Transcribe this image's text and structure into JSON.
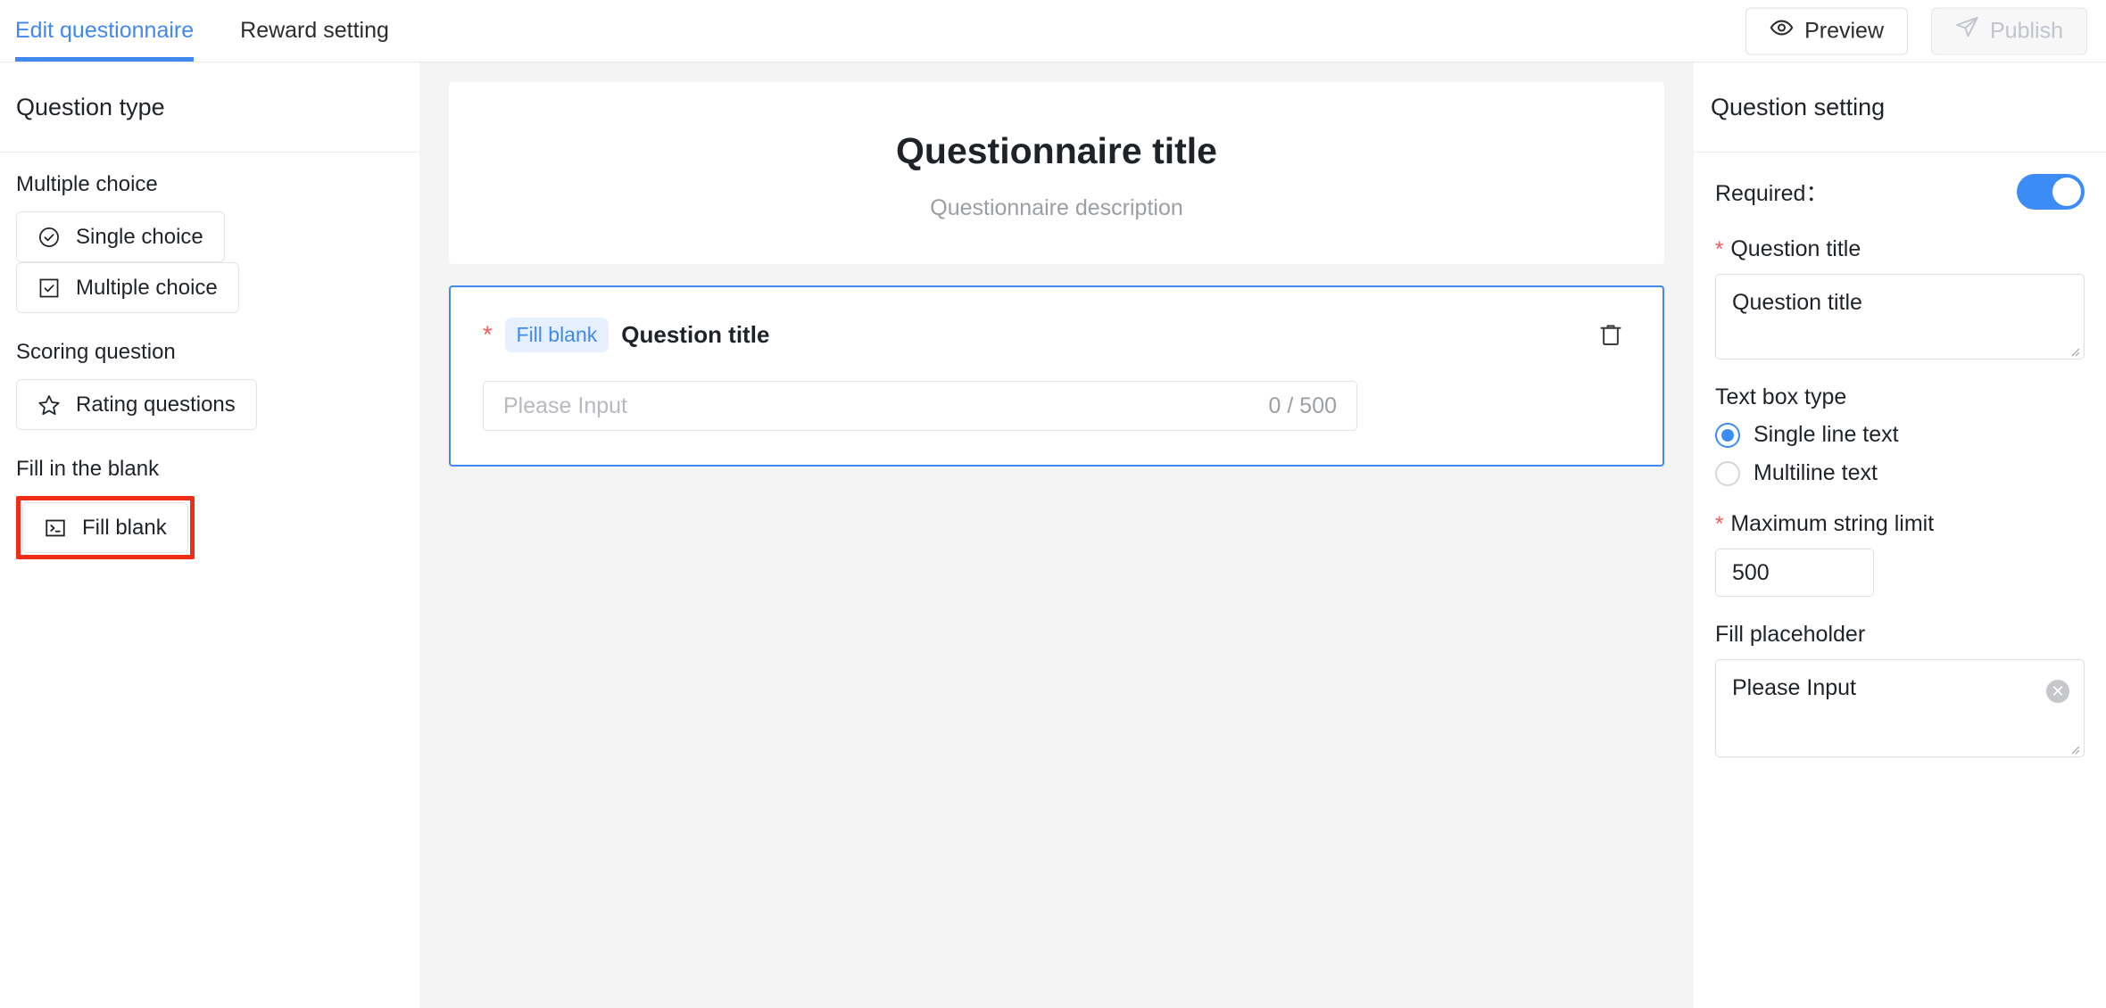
{
  "topbar": {
    "tabs": [
      {
        "label": "Edit questionnaire",
        "active": true
      },
      {
        "label": "Reward setting",
        "active": false
      }
    ],
    "preview_label": "Preview",
    "publish_label": "Publish",
    "preview_icon": "eye-icon",
    "publish_icon": "send-icon",
    "accent_color": "#4189f0"
  },
  "sidebar": {
    "title": "Question type",
    "groups": [
      {
        "label": "Multiple choice",
        "items": [
          {
            "label": "Single choice",
            "icon": "circle-check-icon",
            "highlighted": false
          },
          {
            "label": "Multiple choice",
            "icon": "square-check-icon",
            "highlighted": false
          }
        ]
      },
      {
        "label": "Scoring question",
        "items": [
          {
            "label": "Rating questions",
            "icon": "star-icon",
            "highlighted": false
          }
        ]
      },
      {
        "label": "Fill in the blank",
        "items": [
          {
            "label": "Fill blank",
            "icon": "terminal-icon",
            "highlighted": true
          }
        ]
      }
    ],
    "highlight_color": "#f22d16"
  },
  "center": {
    "questionnaire_title": "Questionnaire title",
    "questionnaire_description": "Questionnaire description",
    "question": {
      "required_marker": "*",
      "tag": "Fill blank",
      "title": "Question title",
      "delete_icon": "trash-icon",
      "input_placeholder": "Please Input",
      "char_counter": "0 / 500"
    }
  },
  "right_panel": {
    "title": "Question setting",
    "required_label": "Required：",
    "required_on": true,
    "question_title_label": "Question title",
    "question_title_required_marker": "*",
    "question_title_value": "Question title",
    "textbox_type_label": "Text box type",
    "textbox_options": [
      {
        "label": "Single line text",
        "selected": true
      },
      {
        "label": "Multiline text",
        "selected": false
      }
    ],
    "max_length_label": "Maximum string limit",
    "max_length_required_marker": "*",
    "max_length_value": "500",
    "fill_placeholder_label": "Fill placeholder",
    "fill_placeholder_value": "Please Input",
    "clear_icon": "circle-close-icon"
  }
}
